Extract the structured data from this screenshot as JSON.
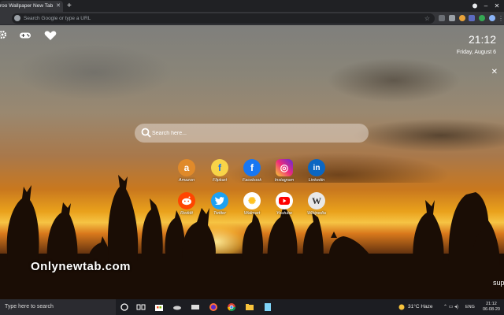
{
  "browser": {
    "tab_title": "roo Wallpaper New Tab Th",
    "tab_close": "✕",
    "new_tab": "+",
    "window_controls": [
      "–",
      "▢",
      "✕"
    ],
    "omnibox_placeholder": "Search Google or type a URL"
  },
  "newtab": {
    "time": "21:12",
    "date": "Friday, August 6",
    "close": "✕",
    "search_placeholder": "Search here...",
    "shortcuts_row1": [
      {
        "label": "Amazon",
        "icon": "amazon-icon",
        "color": "#e08a2a",
        "glyph": "a"
      },
      {
        "label": "Flipkart",
        "icon": "flipkart-icon",
        "color": "#f8d448",
        "glyph": "f"
      },
      {
        "label": "Facebook",
        "icon": "facebook-icon",
        "color": "#1877f2",
        "glyph": "f"
      },
      {
        "label": "Instagram",
        "icon": "instagram-icon",
        "color": "#d6249f",
        "glyph": "◎"
      },
      {
        "label": "Linkedin",
        "icon": "linkedin-icon",
        "color": "#0a66c2",
        "glyph": "in"
      }
    ],
    "shortcuts_row2": [
      {
        "label": "Reddit",
        "icon": "reddit-icon",
        "color": "#ff4500",
        "glyph": "●"
      },
      {
        "label": "Twitter",
        "icon": "twitter-icon",
        "color": "#1da1f2",
        "glyph": "✦"
      },
      {
        "label": "Walmart",
        "icon": "walmart-icon",
        "color": "#ffffff",
        "glyph": "✺"
      },
      {
        "label": "Youtube",
        "icon": "youtube-icon",
        "color": "#ffffff",
        "glyph": "▶"
      },
      {
        "label": "Wikipedia",
        "icon": "wikipedia-icon",
        "color": "#e8e8e8",
        "glyph": "W"
      }
    ],
    "brand": "Onlynewtab.com",
    "sup": "sup"
  },
  "taskbar": {
    "search_placeholder": "Type here to search",
    "weather": "31°C  Haze",
    "lang": "ENG",
    "clock_time": "21:12",
    "clock_date": "06-08-20"
  }
}
